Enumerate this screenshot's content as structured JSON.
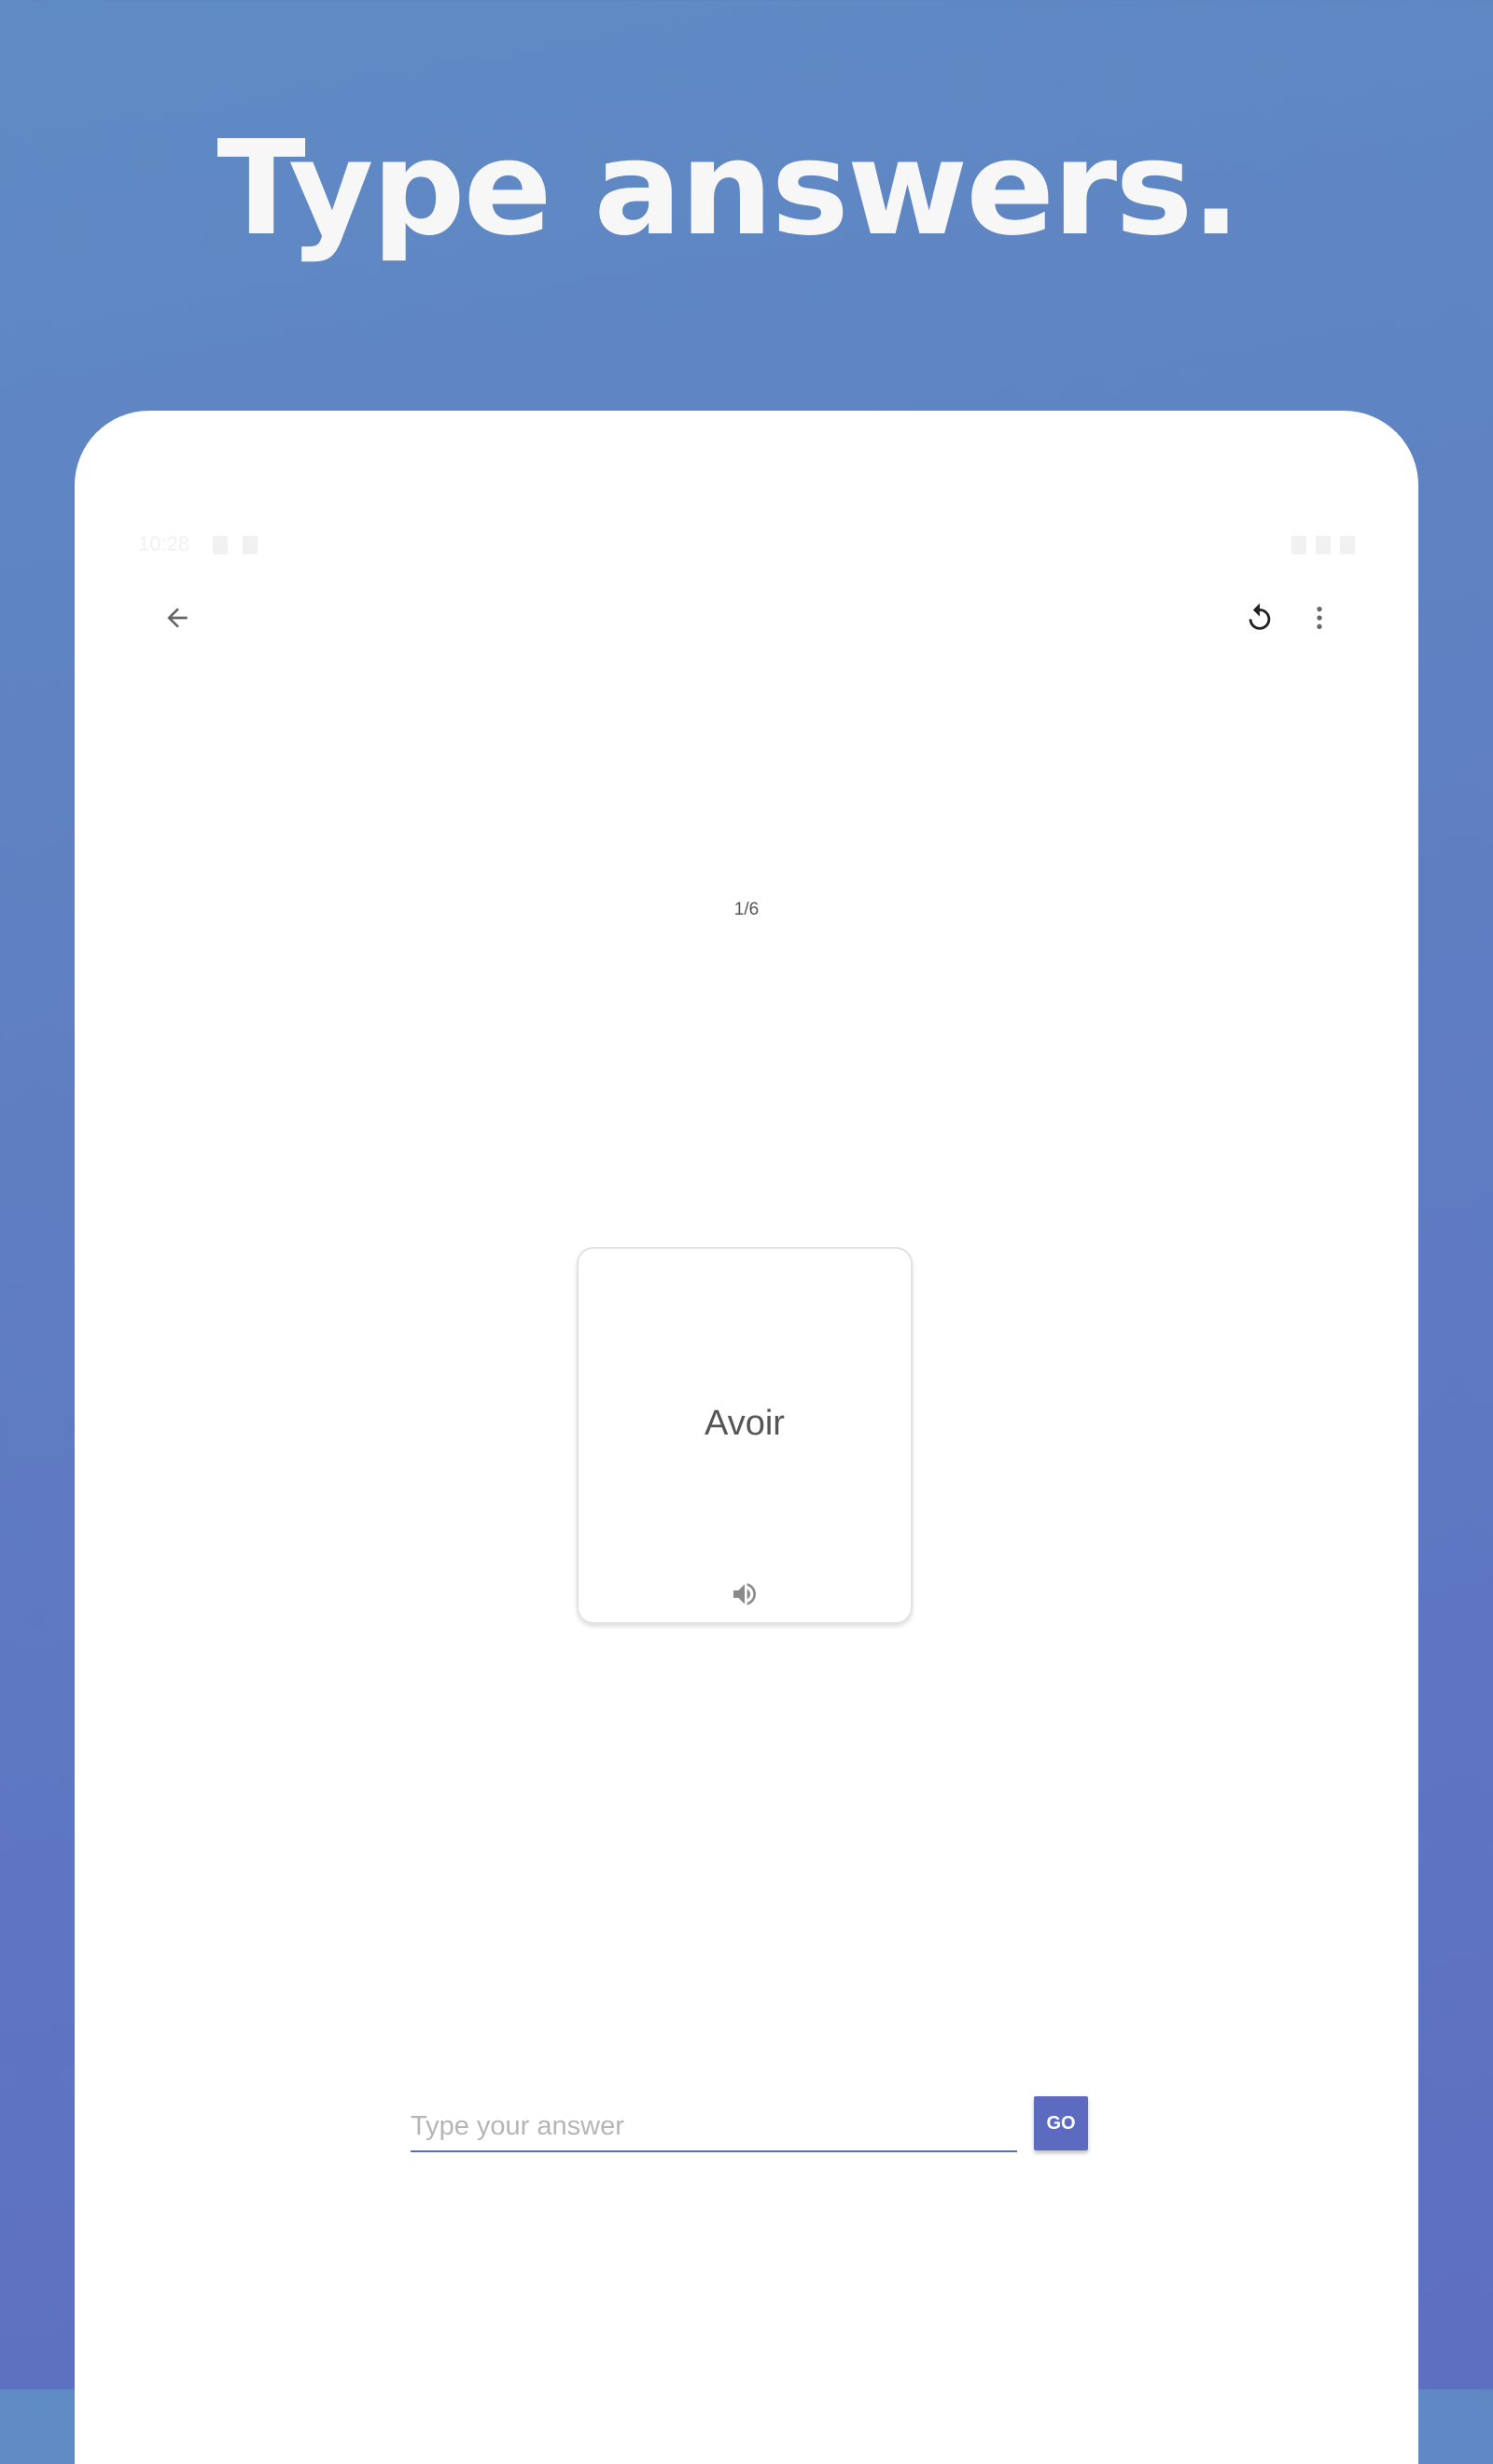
{
  "headline": "Type answers.",
  "status_bar": {
    "time": "10:28"
  },
  "toolbar": {
    "back_icon": "arrow-back-icon",
    "undo_icon": "undo-icon",
    "more_icon": "more-vert-icon"
  },
  "progress": {
    "label": "1/6",
    "current": 1,
    "total": 6
  },
  "flashcard": {
    "term": "Avoir",
    "audio_icon": "speaker-icon"
  },
  "answer": {
    "placeholder": "Type your answer",
    "value": "",
    "go_label": "GO"
  },
  "colors": {
    "background_gradient_top": "#5f8bc4",
    "background_gradient_bottom": "#5e6ec1",
    "accent": "#5c6bc0",
    "headline_text": "#f7f7f7"
  }
}
